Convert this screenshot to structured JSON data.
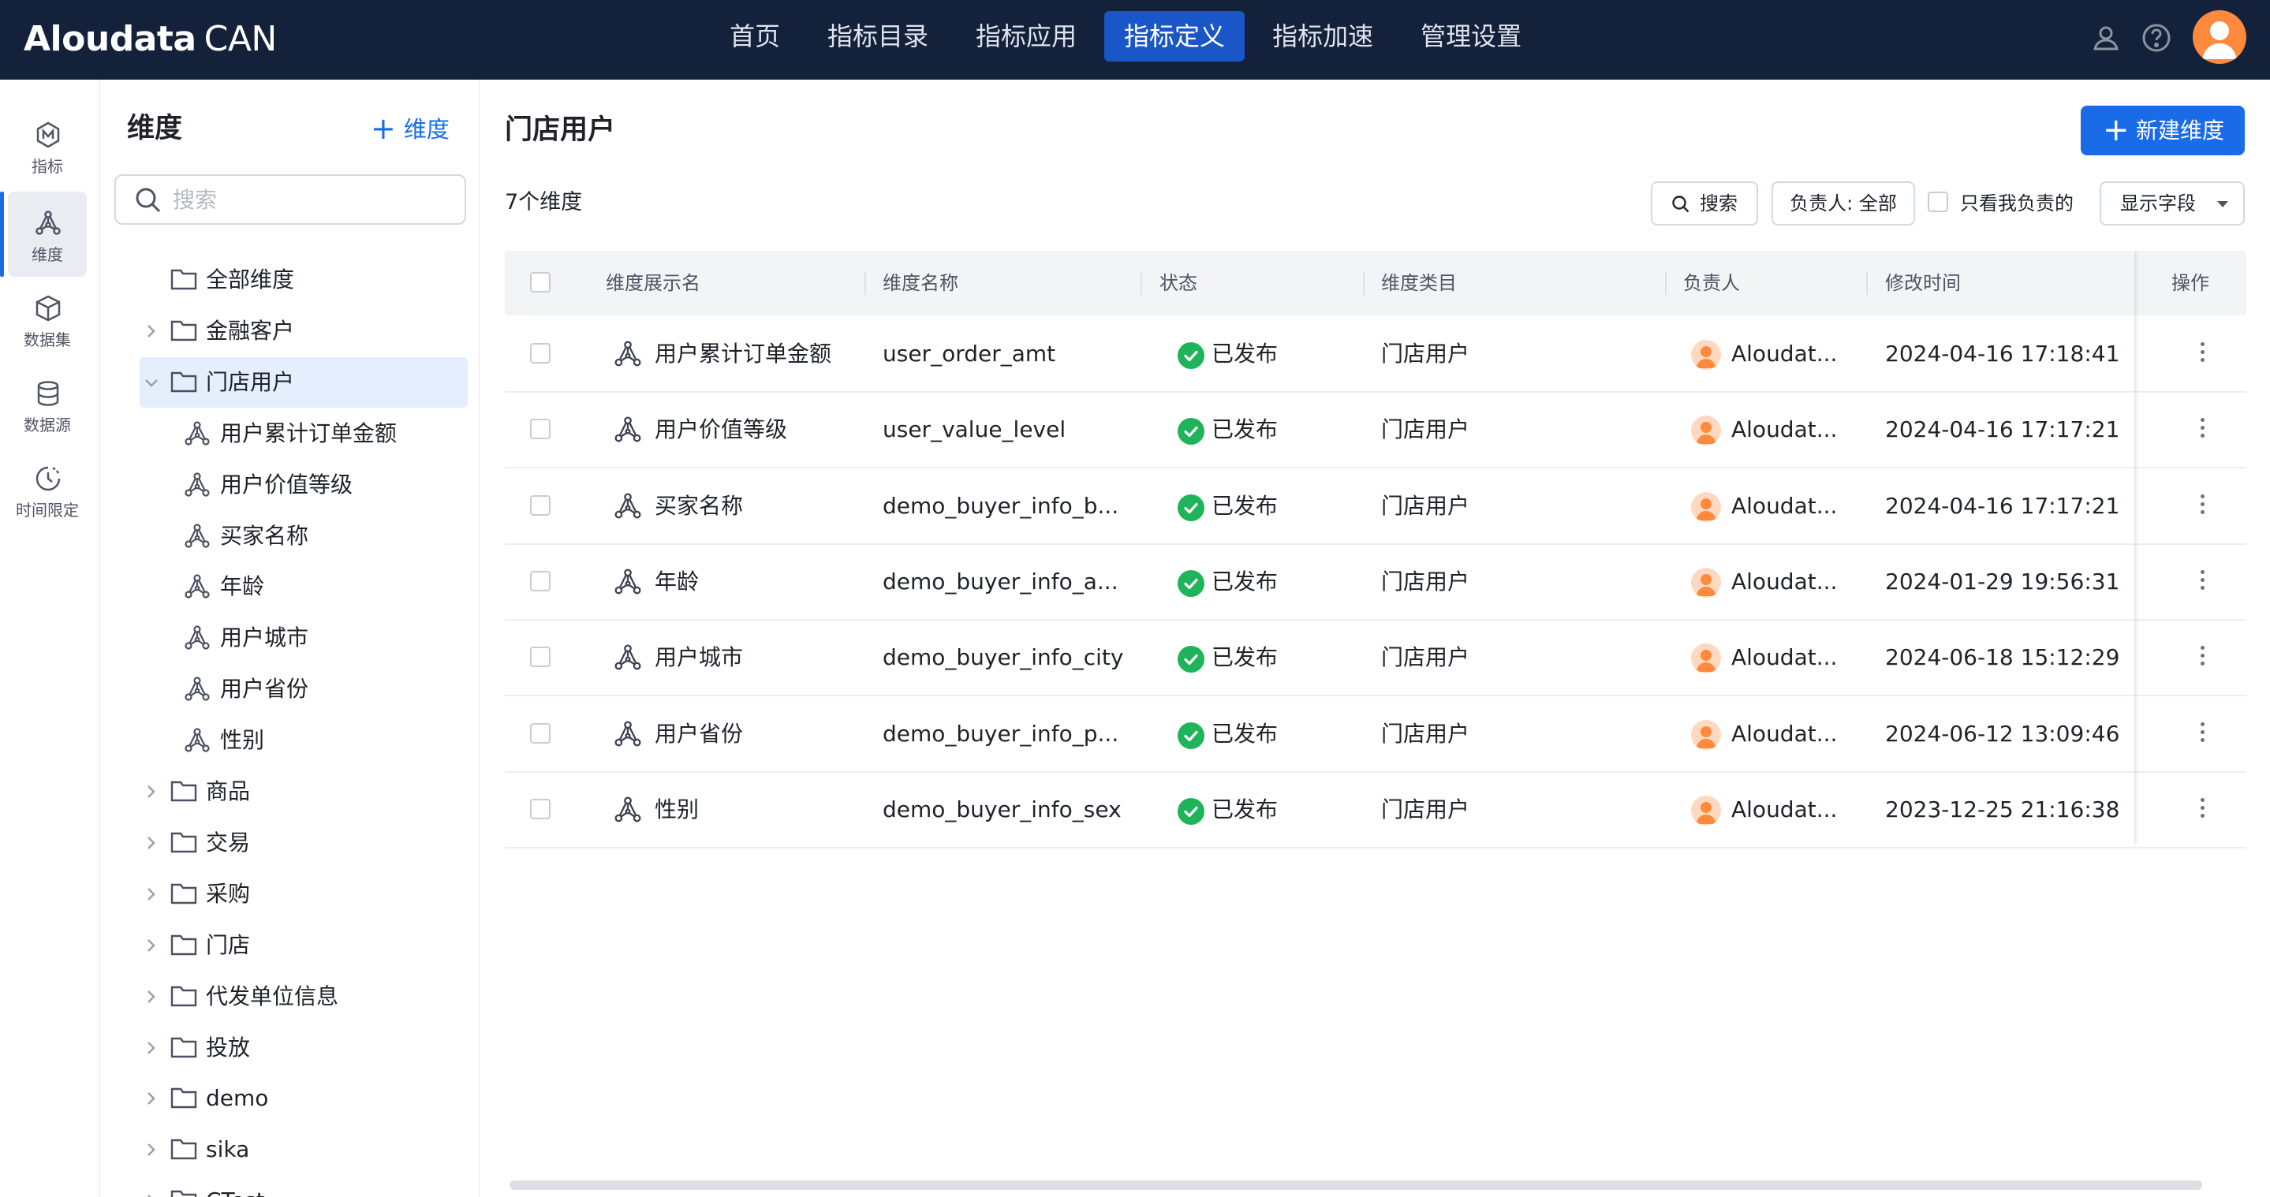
{
  "topbar": {
    "logo_brand": "Aloudata",
    "logo_sub": "CAN",
    "nav": [
      {
        "label": "首页",
        "active": false
      },
      {
        "label": "指标目录",
        "active": false
      },
      {
        "label": "指标应用",
        "active": false
      },
      {
        "label": "指标定义",
        "active": true
      },
      {
        "label": "指标加速",
        "active": false
      },
      {
        "label": "管理设置",
        "active": false
      }
    ],
    "icons": [
      "user-icon",
      "help-icon",
      "avatar"
    ]
  },
  "rail": {
    "items": [
      {
        "label": "指标",
        "icon": "metric-icon",
        "active": false
      },
      {
        "label": "维度",
        "icon": "dimension-icon",
        "active": true
      },
      {
        "label": "数据集",
        "icon": "dataset-icon",
        "active": false
      },
      {
        "label": "数据源",
        "icon": "datasource-icon",
        "active": false
      },
      {
        "label": "时间限定",
        "icon": "time-limit-icon",
        "active": false
      }
    ]
  },
  "tree": {
    "title": "维度",
    "add_label": "维度",
    "search_placeholder": "搜索",
    "nodes": [
      {
        "label": "全部维度",
        "type": "folder",
        "caret": false
      },
      {
        "label": "金融客户",
        "type": "folder",
        "caret": "collapsed"
      },
      {
        "label": "门店用户",
        "type": "folder",
        "caret": "expanded",
        "active": true
      },
      {
        "label": "用户累计订单金额",
        "type": "dimension"
      },
      {
        "label": "用户价值等级",
        "type": "dimension"
      },
      {
        "label": "买家名称",
        "type": "dimension"
      },
      {
        "label": "年龄",
        "type": "dimension"
      },
      {
        "label": "用户城市",
        "type": "dimension"
      },
      {
        "label": "用户省份",
        "type": "dimension"
      },
      {
        "label": "性别",
        "type": "dimension"
      },
      {
        "label": "商品",
        "type": "folder",
        "caret": "collapsed"
      },
      {
        "label": "交易",
        "type": "folder",
        "caret": "collapsed"
      },
      {
        "label": "采购",
        "type": "folder",
        "caret": "collapsed"
      },
      {
        "label": "门店",
        "type": "folder",
        "caret": "collapsed"
      },
      {
        "label": "代发单位信息",
        "type": "folder",
        "caret": "collapsed"
      },
      {
        "label": "投放",
        "type": "folder",
        "caret": "collapsed"
      },
      {
        "label": "demo",
        "type": "folder",
        "caret": "collapsed"
      },
      {
        "label": "sika",
        "type": "folder",
        "caret": "collapsed"
      },
      {
        "label": "CTest",
        "type": "folder",
        "caret": "collapsed"
      }
    ]
  },
  "main": {
    "title": "门店用户",
    "new_button": "新建维度",
    "count_text": "7个维度",
    "toolbar": {
      "search_label": "搜索",
      "owner_filter": "负责人: 全部",
      "mine_only_label": "只看我负责的",
      "fields_label": "显示字段"
    },
    "columns": [
      "维度展示名",
      "维度名称",
      "状态",
      "维度类目",
      "负责人",
      "修改时间",
      "操作"
    ],
    "rows": [
      {
        "display_name": "用户累计订单金额",
        "name": "user_order_amt",
        "status": "已发布",
        "category": "门店用户",
        "owner": "Aloudat...",
        "modified": "2024-04-16 17:18:41"
      },
      {
        "display_name": "用户价值等级",
        "name": "user_value_level",
        "status": "已发布",
        "category": "门店用户",
        "owner": "Aloudat...",
        "modified": "2024-04-16 17:17:21"
      },
      {
        "display_name": "买家名称",
        "name": "demo_buyer_info_b...",
        "status": "已发布",
        "category": "门店用户",
        "owner": "Aloudat...",
        "modified": "2024-04-16 17:17:21"
      },
      {
        "display_name": "年龄",
        "name": "demo_buyer_info_a...",
        "status": "已发布",
        "category": "门店用户",
        "owner": "Aloudat...",
        "modified": "2024-01-29 19:56:31"
      },
      {
        "display_name": "用户城市",
        "name": "demo_buyer_info_city",
        "status": "已发布",
        "category": "门店用户",
        "owner": "Aloudat...",
        "modified": "2024-06-18 15:12:29"
      },
      {
        "display_name": "用户省份",
        "name": "demo_buyer_info_p...",
        "status": "已发布",
        "category": "门店用户",
        "owner": "Aloudat...",
        "modified": "2024-06-12 13:09:46"
      },
      {
        "display_name": "性别",
        "name": "demo_buyer_info_sex",
        "status": "已发布",
        "category": "门店用户",
        "owner": "Aloudat...",
        "modified": "2023-12-25 21:16:38"
      }
    ]
  },
  "colors": {
    "topbar_bg": "#14213a",
    "accent": "#1a6be8",
    "nav_active_bg": "#1a56c7",
    "status_published": "#1fb45a",
    "avatar": "#ff8a3d",
    "tree_active_bg": "#e4eefd"
  }
}
